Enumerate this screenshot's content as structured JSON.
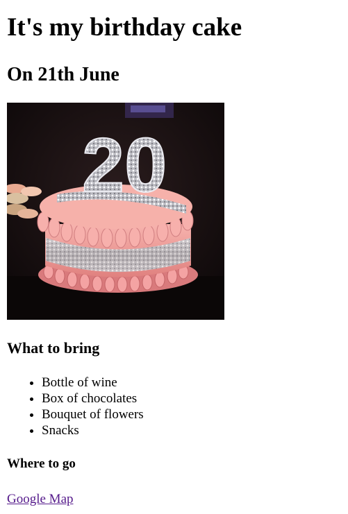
{
  "heading": "It's my birthday cake",
  "subheading": "On 21th June",
  "bring": {
    "title": "What to bring",
    "items": [
      "Bottle of wine",
      "Box of chocolates",
      "Bouquet of flowers",
      "Snacks"
    ]
  },
  "where": {
    "title": "Where to go",
    "link_label": "Google Map"
  },
  "cake_topper": "20",
  "colors": {
    "link_visited": "#551a8b",
    "cake_pink": "#f29a9a",
    "background": "#ffffff"
  }
}
